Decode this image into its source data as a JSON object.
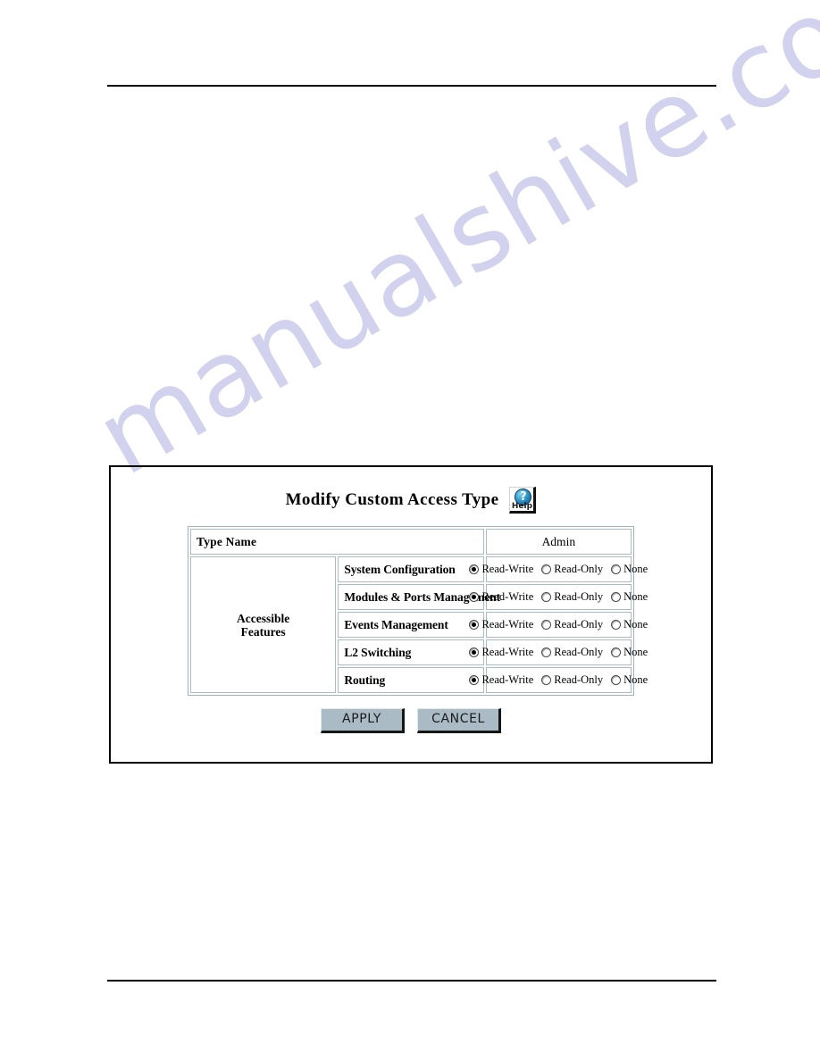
{
  "page": {
    "watermark": "manualshive.com",
    "header_rule": true,
    "footer_rule": true
  },
  "dialog": {
    "title": "Modify Custom Access Type",
    "help_button": {
      "icon": "question-mark-icon",
      "label": "Help",
      "glyph": "?"
    },
    "table": {
      "header": {
        "type_name_label": "Type Name",
        "type_name_value": "",
        "admin_label": "Admin"
      },
      "group_label": "Accessible Features",
      "group_label_line1": "Accessible",
      "group_label_line2": "Features",
      "options": [
        "Read-Write",
        "Read-Only",
        "None"
      ],
      "rows": [
        {
          "feature": "System Configuration",
          "selected": "Read-Write"
        },
        {
          "feature": "Modules & Ports Management",
          "selected": "Read-Write"
        },
        {
          "feature": "Events Management",
          "selected": "Read-Write"
        },
        {
          "feature": "L2 Switching",
          "selected": "Read-Write"
        },
        {
          "feature": "Routing",
          "selected": "Read-Write"
        }
      ]
    },
    "buttons": {
      "apply": "APPLY",
      "cancel": "CANCEL"
    }
  },
  "colors": {
    "button_face": "#aabbc6",
    "table_border": "#a8bcc8",
    "watermark": "#d2d2ef",
    "help_icon_blue": "#2a8fc4"
  }
}
